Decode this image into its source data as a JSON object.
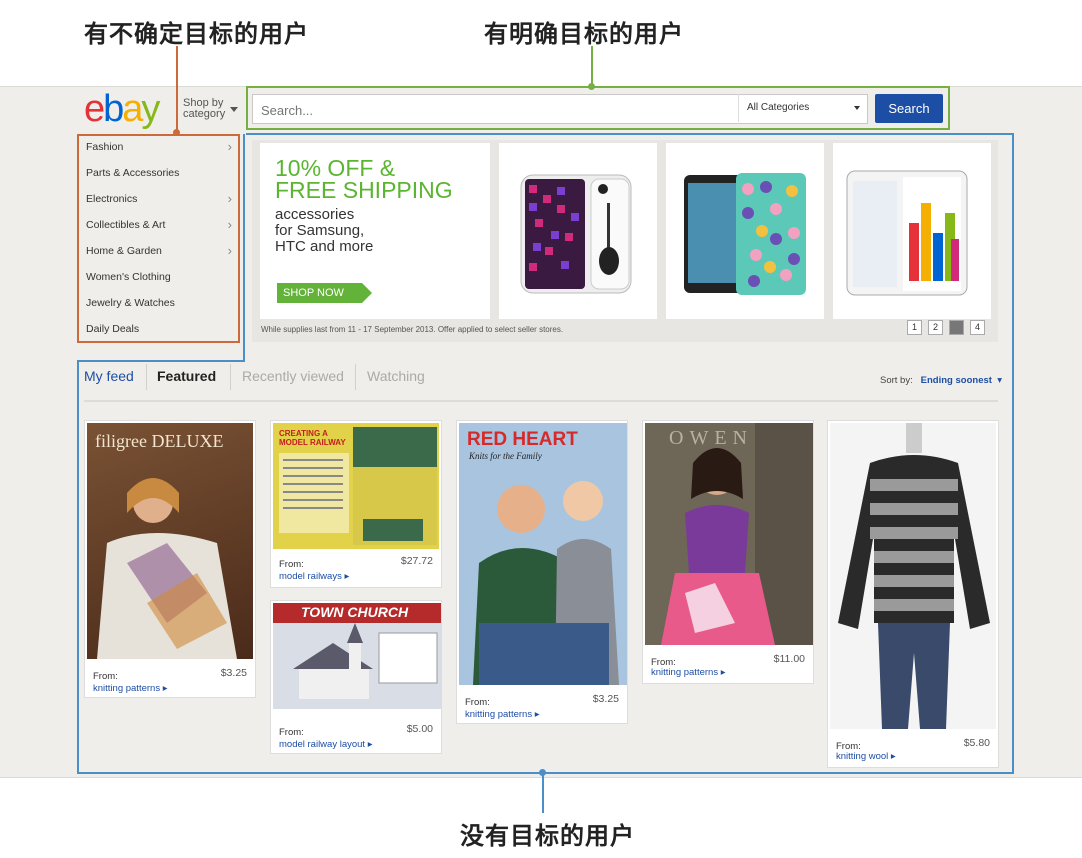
{
  "annotations": {
    "uncertain_users": "有不确定目标的用户",
    "clear_users": "有明确目标的用户",
    "no_goal_users": "没有目标的用户"
  },
  "header": {
    "logo_letters": [
      "e",
      "b",
      "a",
      "y"
    ],
    "shop_by": "Shop by",
    "category": "category",
    "search_placeholder": "Search...",
    "category_select": "All Categories",
    "search_button": "Search"
  },
  "categories": [
    {
      "label": "Fashion",
      "chevron": true
    },
    {
      "label": "Parts & Accessories",
      "chevron": false
    },
    {
      "label": "Electronics",
      "chevron": true
    },
    {
      "label": "Collectibles & Art",
      "chevron": true
    },
    {
      "label": "Home & Garden",
      "chevron": true
    },
    {
      "label": "Women's Clothing",
      "chevron": false
    },
    {
      "label": "Jewelry & Watches",
      "chevron": false
    },
    {
      "label": "Daily Deals",
      "chevron": false
    }
  ],
  "promo": {
    "line1": "10% OFF &",
    "line2": "FREE SHIPPING",
    "sub1": "accessories",
    "sub2": "for Samsung,",
    "sub3": "HTC and more",
    "cta": "SHOP NOW",
    "disclaimer": "While supplies last from 11 - 17 September 2013. Offer applied to select seller stores.",
    "pages": [
      "1",
      "2",
      "3",
      "4"
    ],
    "active_page": "3"
  },
  "feed": {
    "tabs": [
      "My feed",
      "Featured",
      "Recently viewed",
      "Watching"
    ],
    "sort_label": "Sort by:",
    "sort_value": "Ending soonest"
  },
  "items": [
    {
      "from": "From:",
      "link": "knitting patterns ▸",
      "price": "$3.25",
      "img_text": "filigree DELUXE"
    },
    {
      "from": "From:",
      "link": "model railways ▸",
      "price": "$27.72",
      "img_text": "CREATING A MODEL RAILWAY"
    },
    {
      "from": "From:",
      "link": "model railway layout ▸",
      "price": "$5.00",
      "img_text": "TOWN CHURCH"
    },
    {
      "from": "From:",
      "link": "knitting patterns ▸",
      "price": "$3.25",
      "img_text": "RED HEART",
      "img_sub": "Knits for the Family"
    },
    {
      "from": "From:",
      "link": "knitting patterns ▸",
      "price": "$11.00",
      "img_text": "OWEN"
    },
    {
      "from": "From:",
      "link": "knitting wool ▸",
      "price": "$5.80"
    }
  ],
  "colors": {
    "green_box": "#76b043",
    "orange_box": "#cc6a3a",
    "blue_box": "#4a8fc8",
    "search_blue": "#1d4ea5"
  }
}
